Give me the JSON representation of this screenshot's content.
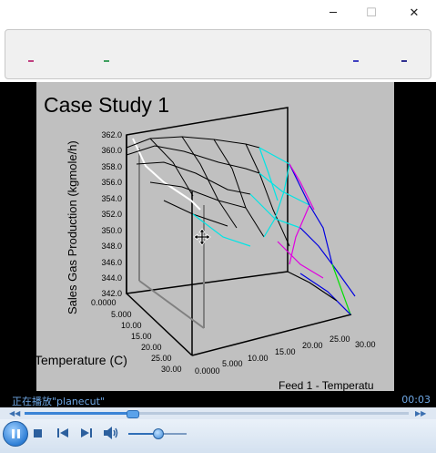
{
  "window": {
    "minimize_glyph": "─",
    "maximize_glyph": "☐",
    "close_glyph": "✕"
  },
  "plot": {
    "title": "Case Study 1",
    "z_axis_label": "Sales Gas Production (kgmole/h)",
    "z_ticks": [
      "362.0",
      "360.0",
      "358.0",
      "356.0",
      "354.0",
      "352.0",
      "350.0",
      "348.0",
      "346.0",
      "344.0",
      "342.0"
    ],
    "left_axis_label": "Temperature (C)",
    "left_ticks": [
      "0.0000",
      "5.000",
      "10.00",
      "15.00",
      "20.00",
      "25.00",
      "30.00"
    ],
    "right_axis_label": "Feed 1 - Temperatu",
    "right_ticks": [
      "0.0000",
      "5.000",
      "10.00",
      "15.00",
      "20.00",
      "25.00",
      "30.00"
    ],
    "colors": {
      "background": "#c0c0c0",
      "mesh": "#000000",
      "cyan": "#00e5e5",
      "magenta": "#e000e0",
      "blue": "#0000e0",
      "green": "#00e000",
      "plane": "#ffffff"
    }
  },
  "status": {
    "now_playing": "正在播放\"planecut\"",
    "time": "00:03"
  },
  "player": {
    "seek_progress": 0.28,
    "volume_level": 0.5,
    "prev_icon": "previous-icon",
    "next_icon": "next-icon",
    "volume_icon": "speaker-icon"
  }
}
